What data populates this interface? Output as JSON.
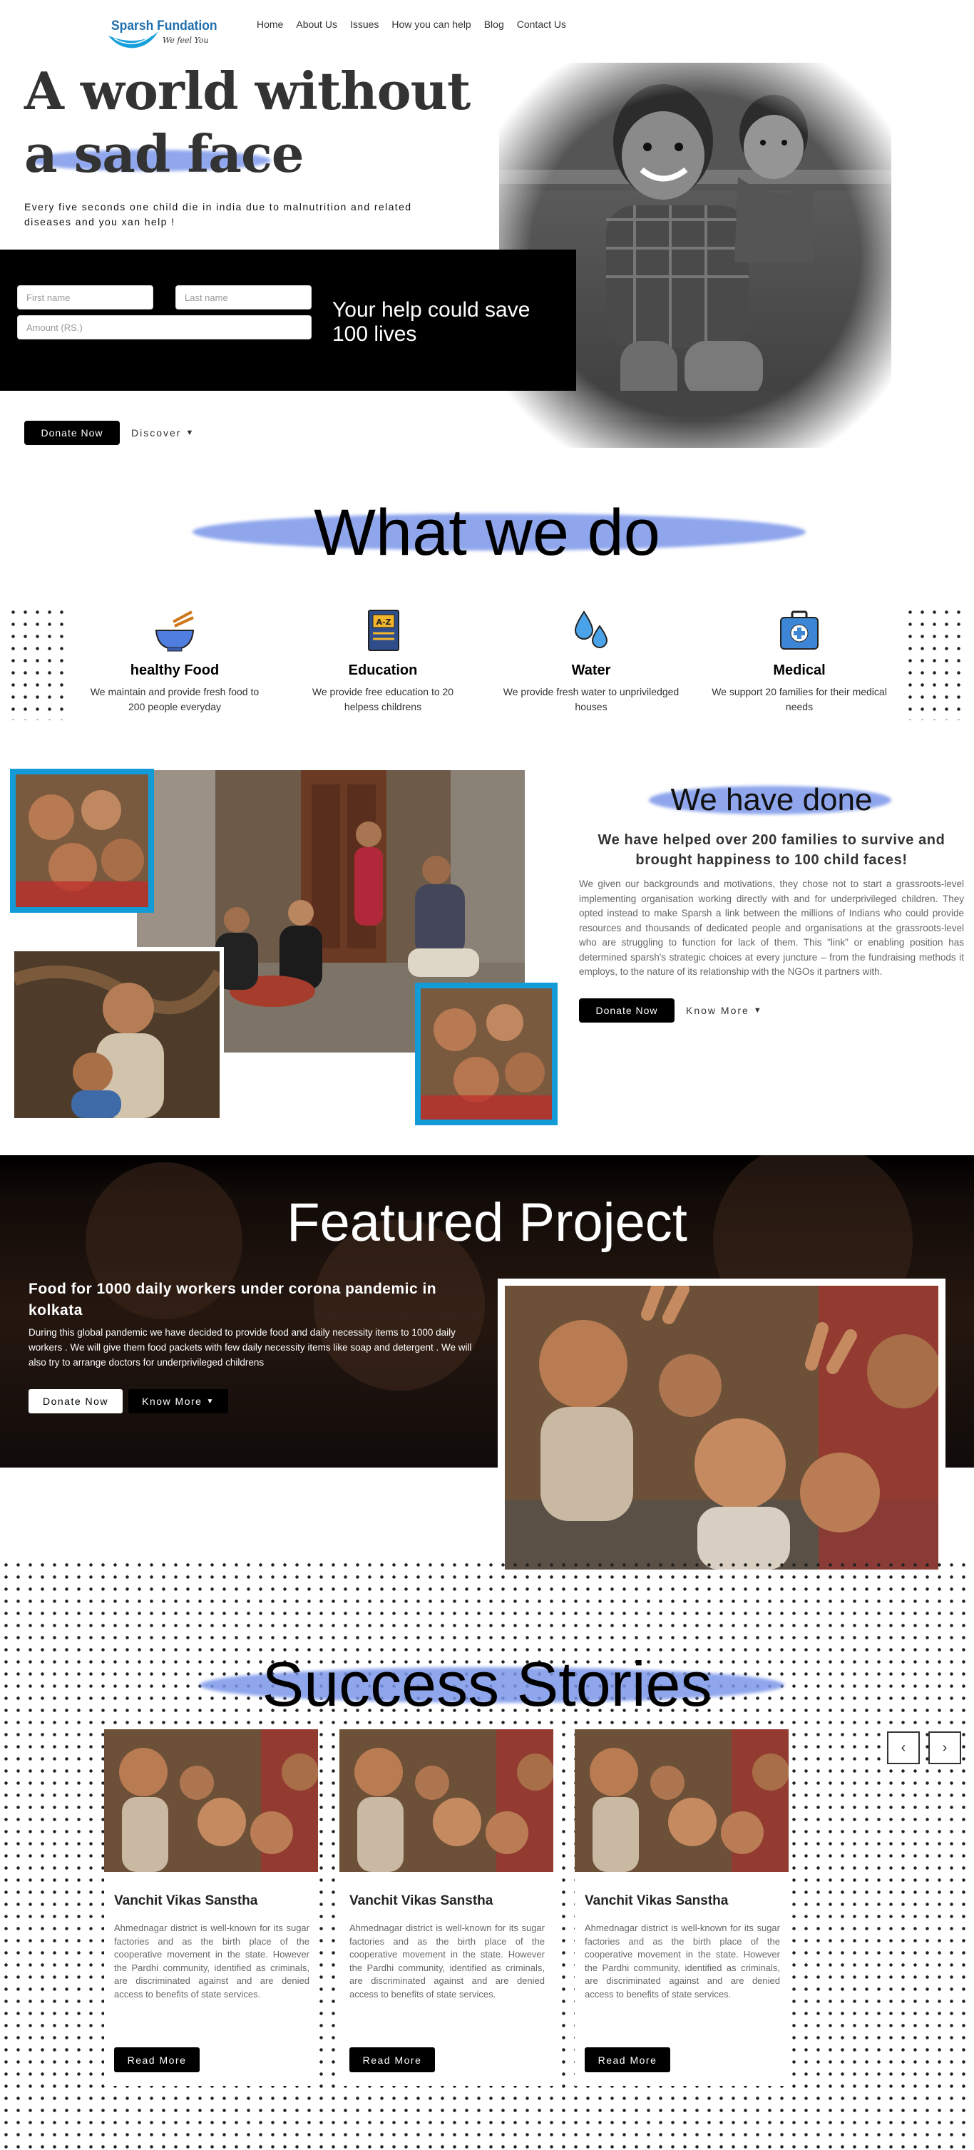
{
  "nav": {
    "brand": "Sparsh Fundation",
    "tagline": "We feel You",
    "links": [
      "Home",
      "About Us",
      "Issues",
      "How you can help",
      "Blog",
      "Contact Us"
    ]
  },
  "hero": {
    "title_line1": "A world without",
    "title_line2": "a sad face",
    "subtitle": "Every five seconds one child die in india due to malnutrition and related diseases and you xan help !",
    "first_name_placeholder": "First name",
    "last_name_placeholder": "Last name",
    "amount_placeholder": "Amount (RS.)",
    "help_text": "Your help could save 100 lives",
    "donate_label": "Donate Now",
    "discover_label": "Discover",
    "chevron": "⌄"
  },
  "what_we_do": {
    "title": "What we do",
    "cards": [
      {
        "title": "healthy Food",
        "text": "We maintain and provide fresh food to 200 people everyday",
        "icon": "food-bowl-icon"
      },
      {
        "title": "Education",
        "text": "We provide free education to 20 helpess childrens",
        "icon": "book-icon"
      },
      {
        "title": "Water",
        "text": "We provide fresh water to unpriviledged houses",
        "icon": "water-drops-icon"
      },
      {
        "title": "Medical",
        "text": "We support 20 families for their medical needs",
        "icon": "medical-kit-icon"
      }
    ]
  },
  "done": {
    "title": "We have done",
    "headline": "We have helped over 200 families to survive and brought happiness to 100 child faces!",
    "body": "We given our backgrounds and motivations, they chose not to start a grassroots-level implementing organisation working directly with and for underprivileged children. They opted instead to make Sparsh a link between the millions of Indians who could provide resources and thousands of dedicated people and organisations at the grassroots-level who are struggling to function for lack of them. This \"link\" or enabling position has determined sparsh's strategic choices at every juncture – from the fundraising methods it employs, to the nature of its relationship with the NGOs it partners with.",
    "donate_label": "Donate Now",
    "know_more_label": "Know More"
  },
  "featured": {
    "title": "Featured Project",
    "headline": "Food for 1000 daily workers under corona pandemic in kolkata",
    "body": "During this global pandemic we have decided to provide food and daily necessity items to 1000 daily workers . We will give them food packets with few daily necessity items like soap and detergent . We will also try to arrange doctors for underprivileged childrens",
    "donate_label": "Donate Now",
    "know_more_label": "Know More"
  },
  "stories": {
    "title": "Success Stories",
    "prev": "‹",
    "next": "›",
    "items": [
      {
        "title": "Vanchit Vikas Sanstha",
        "text": "Ahmednagar district is well-known for its sugar factories and as the birth place of the cooperative movement in the state. However the Pardhi community, identified as criminals, are discriminated against and are denied access to benefits of state services.",
        "button": "Read More"
      },
      {
        "title": "Vanchit Vikas Sanstha",
        "text": "Ahmednagar district is well-known for its sugar factories and as the birth place of the cooperative movement in the state. However the Pardhi community, identified as criminals, are discriminated against and are denied access to benefits of state services.",
        "button": "Read More"
      },
      {
        "title": "Vanchit Vikas Sanstha",
        "text": "Ahmednagar district is well-known for its sugar factories and as the birth place of the cooperative movement in the state. However the Pardhi community, identified as criminals, are discriminated against and are denied access to benefits of state services.",
        "button": "Read More"
      }
    ]
  },
  "colors": {
    "accent_brush": "#6f8ee8",
    "photo_frame": "#129bd6",
    "black": "#000000"
  }
}
